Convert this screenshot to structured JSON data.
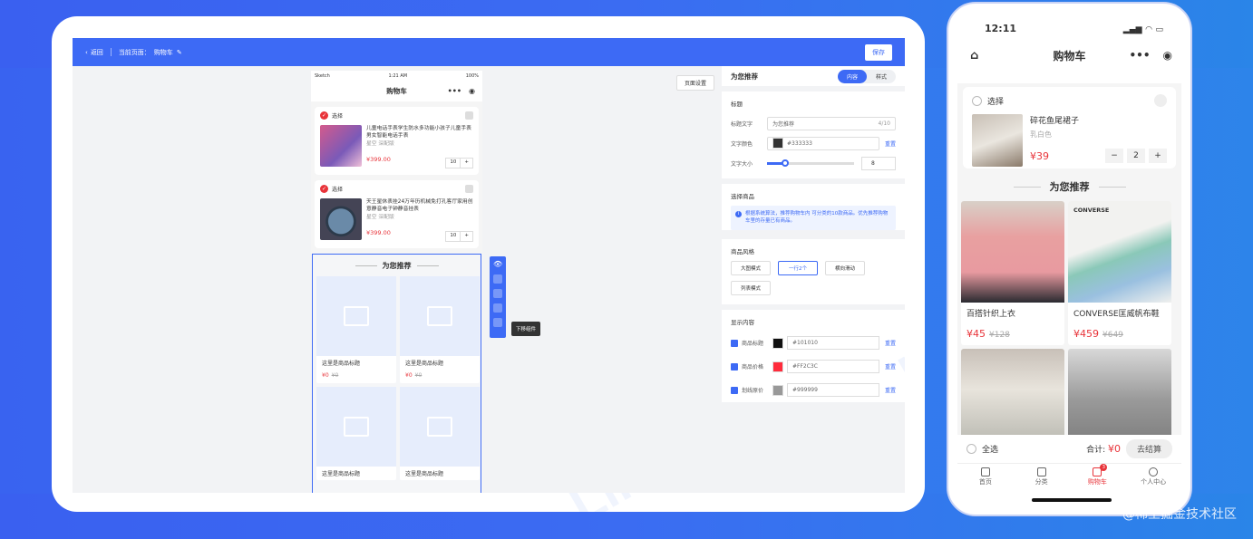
{
  "editor": {
    "topbar": {
      "back": "返回",
      "current": "当前页面：",
      "page": "购物车",
      "save": "保存"
    },
    "page_settings": "页面设置",
    "sim": {
      "status": {
        "carrier": "Sketch",
        "time": "1:21 AM",
        "battery": "100%"
      },
      "nav_title": "购物车",
      "cart": [
        {
          "select": "选择",
          "name": "儿童电话手表学生防水多功能小孩子儿童手表男女智能电话手表",
          "spec": "星空 深配版",
          "price": "¥399.00",
          "qty": "10"
        },
        {
          "select": "选择",
          "name": "天王星休表挂24万年历机械免打孔客厅家用创意静音电子钟静音挂表",
          "spec": "星空 深配版",
          "price": "¥399.00",
          "qty": "10"
        }
      ],
      "rec_title": "为您推荐",
      "rec_items": [
        {
          "name": "这里是商品标题",
          "price": "¥0",
          "old": "¥0"
        },
        {
          "name": "这里是商品标题",
          "price": "¥0",
          "old": "¥0"
        },
        {
          "name": "这里是商品标题"
        },
        {
          "name": "这里是商品标题"
        }
      ],
      "tooltip": "下移组件"
    },
    "panel": {
      "title": "为您推荐",
      "tabs": {
        "content": "内容",
        "style": "样式"
      },
      "heading_section": {
        "label": "标题",
        "title_text_label": "标题文字",
        "title_text_value": "为您推荐",
        "title_text_count": "4/10",
        "text_color_label": "文字颜色",
        "text_color_value": "#333333",
        "reset": "重置",
        "font_size_label": "文字大小",
        "font_size_value": "8"
      },
      "goods_section": {
        "label": "选择商品",
        "info": "根据系统算法，推荐购物车内 可分类的10款商品。优先推荐购物车里的存量已有商品。"
      },
      "style_section": {
        "label": "商品风格",
        "options": [
          "大图模式",
          "一行2个",
          "横向滑动",
          "列表模式"
        ]
      },
      "display_section": {
        "label": "显示内容",
        "rows": [
          {
            "label": "商品标题",
            "color": "#101010",
            "reset": "重置"
          },
          {
            "label": "商品价格",
            "color": "#FF2C3C",
            "reset": "重置"
          },
          {
            "label": "划线原价",
            "color": "#999999",
            "reset": "重置"
          }
        ]
      }
    }
  },
  "phone": {
    "time": "12:11",
    "title": "购物车",
    "cart": {
      "select": "选择",
      "name": "碎花鱼尾裙子",
      "spec": "乳白色",
      "price": "¥39",
      "qty": "2"
    },
    "rec_title": "为您推荐",
    "products": [
      {
        "name": "百搭针织上衣",
        "price": "¥45",
        "old": "¥128"
      },
      {
        "name": "CONVERSE匡威帆布鞋",
        "price": "¥459",
        "old": "¥649",
        "brand": "CONVERSE"
      },
      {
        "name": ""
      },
      {
        "name": ""
      }
    ],
    "footer": {
      "select_all": "全选",
      "total_label": "合计:",
      "total_value": "¥0",
      "checkout": "去结算"
    },
    "tabs": [
      {
        "label": "首页"
      },
      {
        "label": "分类"
      },
      {
        "label": "购物车",
        "badge": "3"
      },
      {
        "label": "个人中心"
      }
    ]
  },
  "watermarks": [
    "Likeshop",
    "Likeshop",
    "Likeshop"
  ],
  "corner_mark": "@稀土掘金技术社区",
  "colors": {
    "accent": "#3d6af5",
    "price": "#e8343a"
  }
}
